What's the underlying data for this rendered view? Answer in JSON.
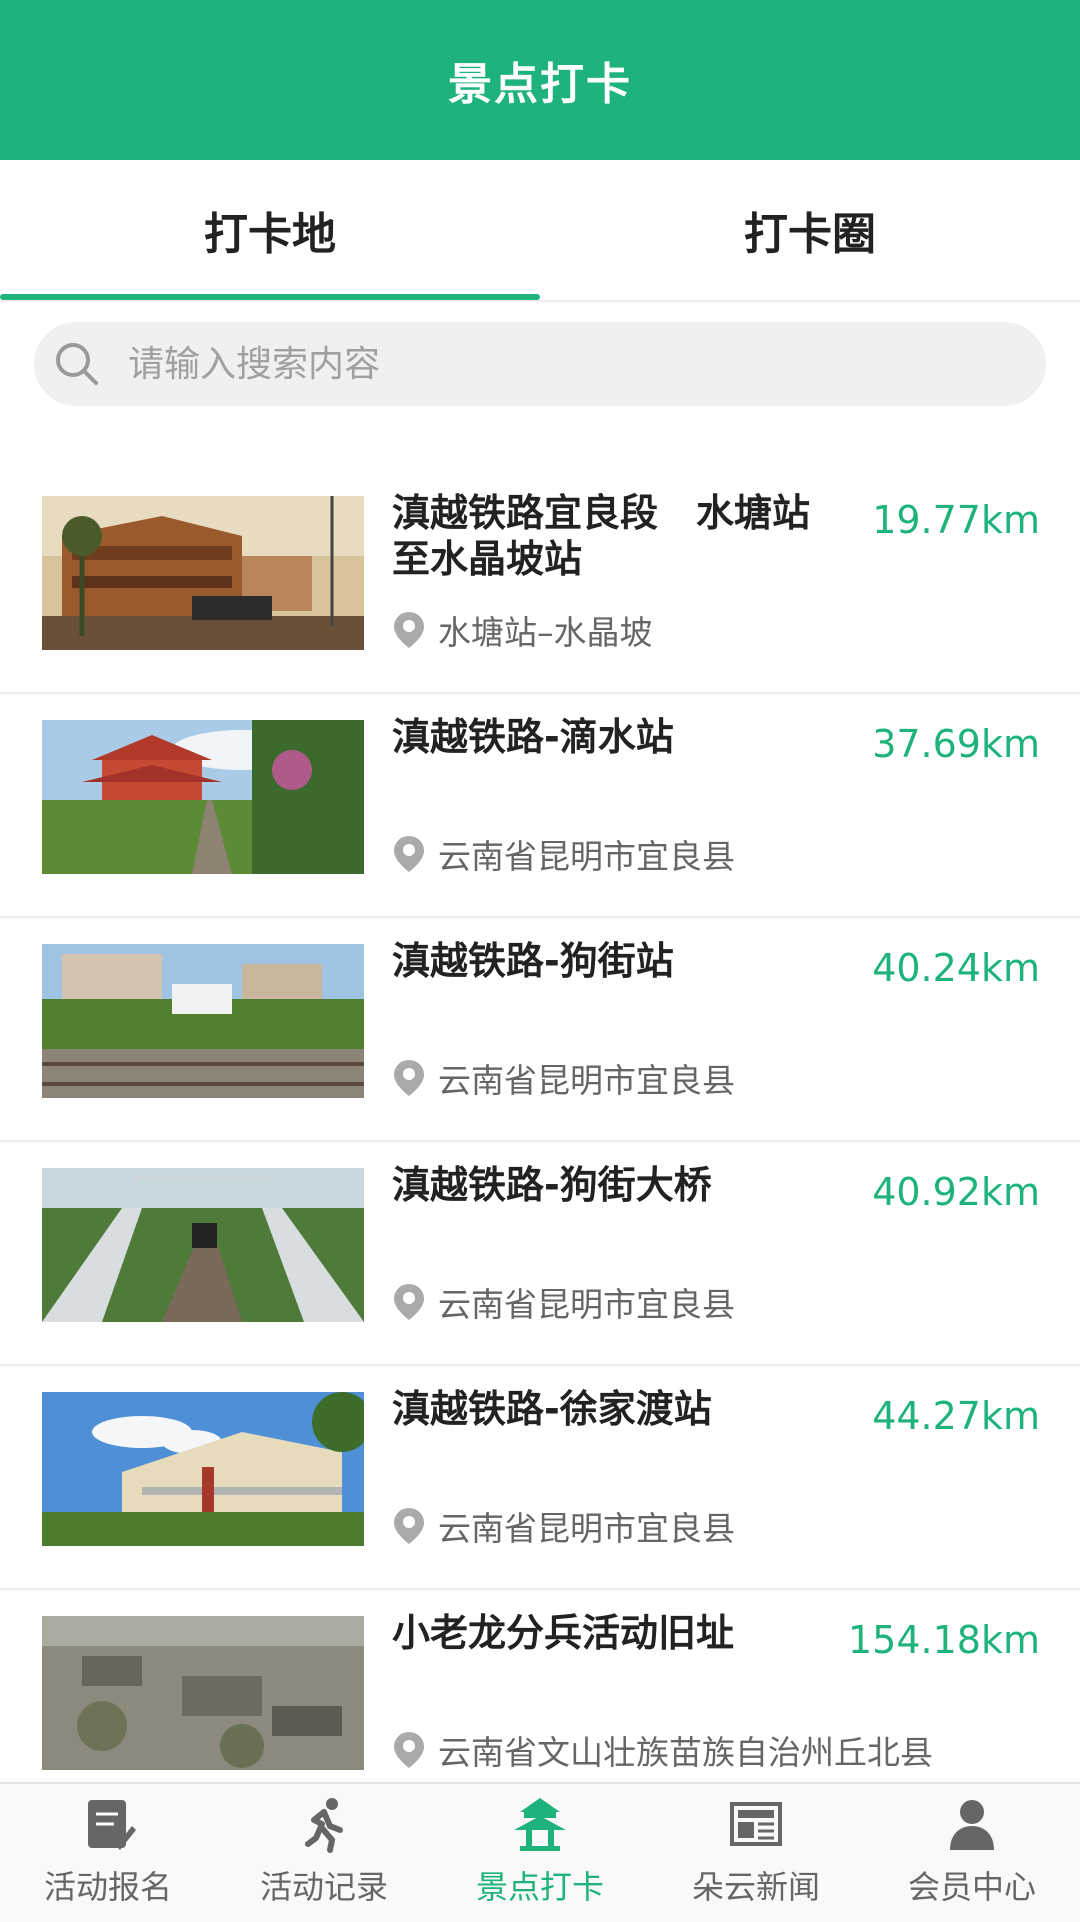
{
  "header": {
    "title": "景点打卡"
  },
  "tabs": [
    {
      "label": "打卡地",
      "active": true
    },
    {
      "label": "打卡圈",
      "active": false
    }
  ],
  "search": {
    "placeholder": "请输入搜索内容",
    "icon": "search-icon"
  },
  "spots": [
    {
      "title": "滇越铁路宜良段　水塘站至水晶坡站",
      "distance": "19.77km",
      "address": "水塘站–水晶坡"
    },
    {
      "title": "滇越铁路-滴水站",
      "distance": "37.69km",
      "address": "云南省昆明市宜良县"
    },
    {
      "title": "滇越铁路-狗街站",
      "distance": "40.24km",
      "address": "云南省昆明市宜良县"
    },
    {
      "title": "滇越铁路-狗街大桥",
      "distance": "40.92km",
      "address": "云南省昆明市宜良县"
    },
    {
      "title": "滇越铁路-徐家渡站",
      "distance": "44.27km",
      "address": "云南省昆明市宜良县"
    },
    {
      "title": "小老龙分兵活动旧址",
      "distance": "154.18km",
      "address": "云南省文山壮族苗族自治州丘北县"
    }
  ],
  "tabbar": [
    {
      "label": "活动报名",
      "icon": "signup-form-icon",
      "active": false
    },
    {
      "label": "活动记录",
      "icon": "running-icon",
      "active": false
    },
    {
      "label": "景点打卡",
      "icon": "pavilion-icon",
      "active": true
    },
    {
      "label": "朵云新闻",
      "icon": "news-icon",
      "active": false
    },
    {
      "label": "会员中心",
      "icon": "user-icon",
      "active": false
    }
  ],
  "colors": {
    "brand": "#1db37a",
    "text": "#222222",
    "muted": "#666666"
  }
}
